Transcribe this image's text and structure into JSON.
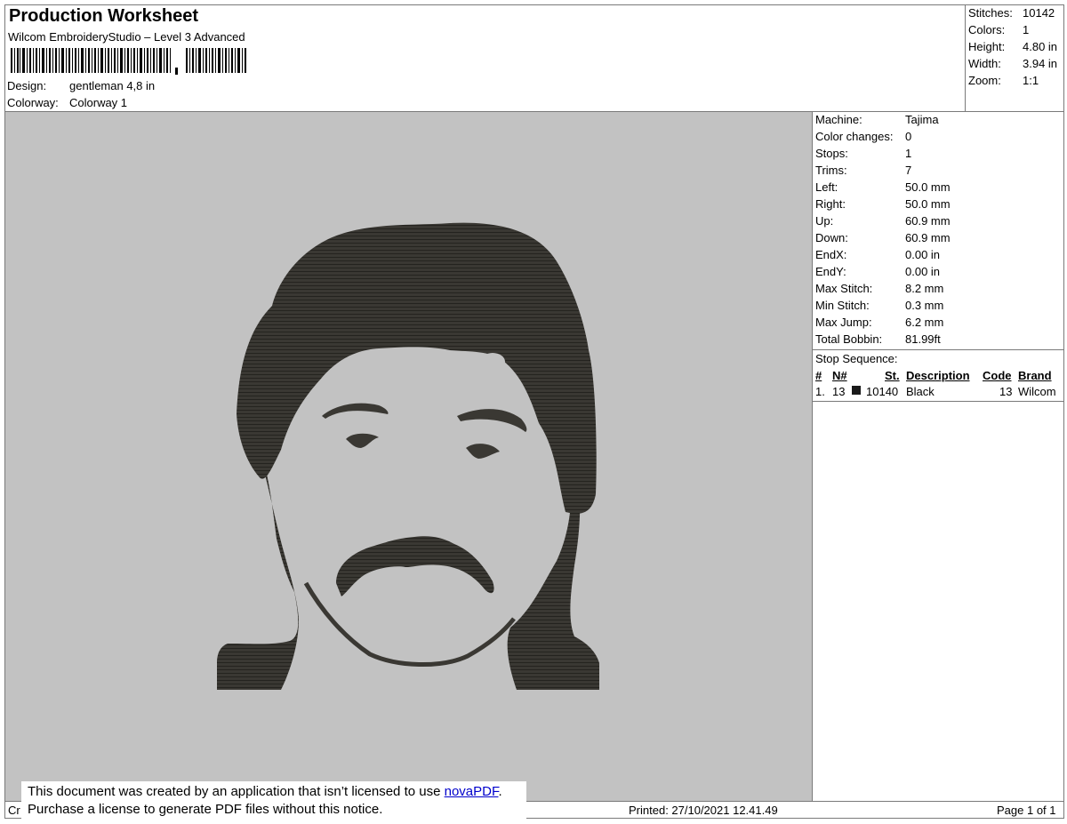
{
  "header": {
    "title": "Production Worksheet",
    "subtitle": "Wilcom EmbroideryStudio – Level 3 Advanced",
    "design_label": "Design:",
    "design_value": "gentleman 4,8 in",
    "colorway_label": "Colorway:",
    "colorway_value": "Colorway 1"
  },
  "stats": [
    {
      "label": "Stitches:",
      "value": "10142"
    },
    {
      "label": "Colors:",
      "value": "1"
    },
    {
      "label": "Height:",
      "value": "4.80 in"
    },
    {
      "label": "Width:",
      "value": "3.94 in"
    },
    {
      "label": "Zoom:",
      "value": "1:1"
    }
  ],
  "params": [
    {
      "label": "Machine:",
      "value": "Tajima"
    },
    {
      "label": "Color changes:",
      "value": "0"
    },
    {
      "label": "Stops:",
      "value": "1"
    },
    {
      "label": "Trims:",
      "value": "7"
    },
    {
      "label": "Left:",
      "value": "50.0 mm"
    },
    {
      "label": "Right:",
      "value": "50.0 mm"
    },
    {
      "label": "Up:",
      "value": "60.9 mm"
    },
    {
      "label": "Down:",
      "value": "60.9 mm"
    },
    {
      "label": "EndX:",
      "value": "0.00 in"
    },
    {
      "label": "EndY:",
      "value": "0.00 in"
    },
    {
      "label": "Max Stitch:",
      "value": "8.2 mm"
    },
    {
      "label": "Min Stitch:",
      "value": "0.3 mm"
    },
    {
      "label": "Max Jump:",
      "value": "6.2 mm"
    },
    {
      "label": "Total Bobbin:",
      "value": "81.99ft"
    }
  ],
  "stop_sequence": {
    "title": "Stop Sequence:",
    "headers": {
      "num": "#",
      "needle": "N#",
      "st": "St.",
      "desc": "Description",
      "code": "Code",
      "brand": "Brand"
    },
    "rows": [
      {
        "num": "1.",
        "needle": "13",
        "st": "10140",
        "desc": "Black",
        "code": "13",
        "brand": "Wilcom",
        "color": "#1a1a1a"
      }
    ]
  },
  "footer": {
    "left": "Cr",
    "printed": "Printed: 27/10/2021 12.41.49",
    "page": "Page 1 of 1"
  },
  "notice": {
    "line1_prefix": "This document was created by an application that isn’t licensed to use ",
    "link": "novaPDF",
    "line1_suffix": ".",
    "line2": "Purchase a license to generate PDF files without this notice."
  },
  "colors": {
    "canvas": "#c2c2c2",
    "thread": "#3a3833"
  }
}
